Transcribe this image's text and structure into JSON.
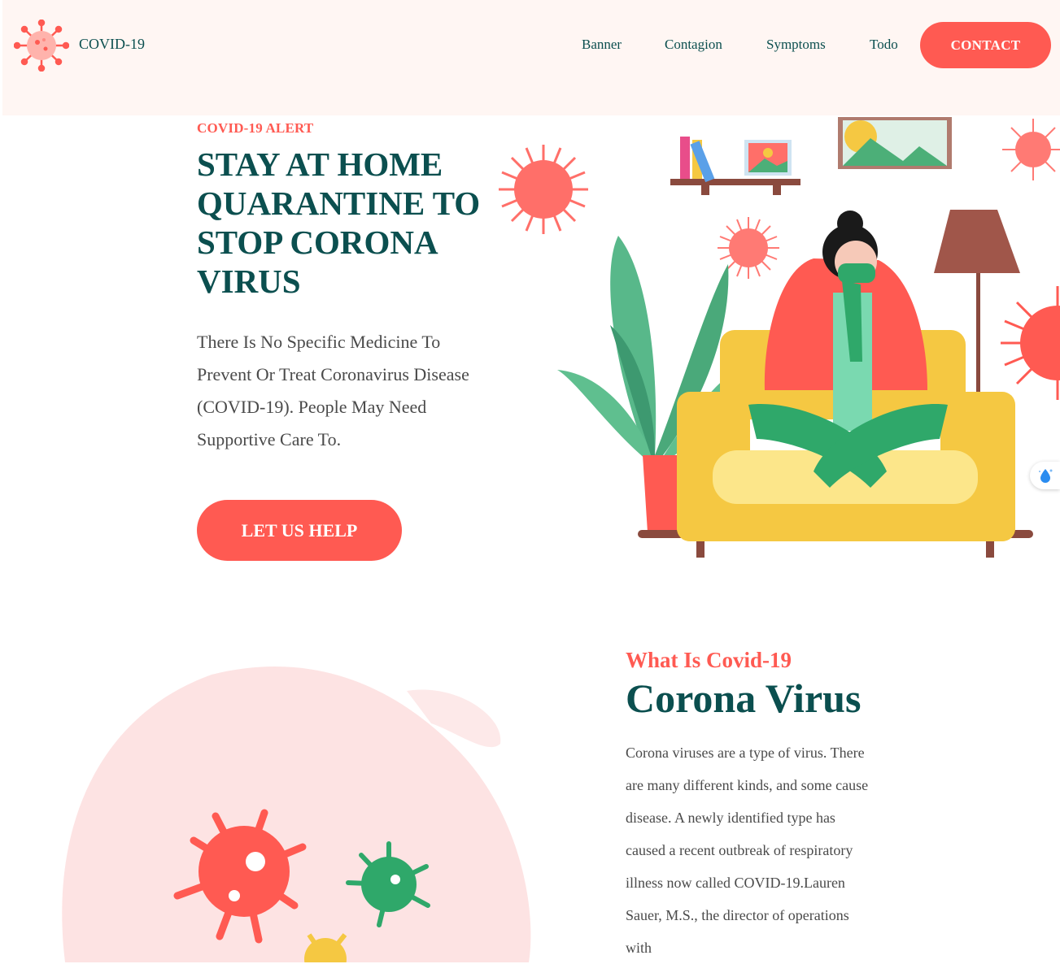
{
  "header": {
    "logo_text": "COVID-19",
    "nav": [
      "Banner",
      "Contagion",
      "Symptoms",
      "Todo"
    ],
    "contact_label": "CONTACT"
  },
  "hero": {
    "eyebrow": "COVID-19 ALERT",
    "title": "STAY AT HOME QUARANTINE TO STOP CORONA VIRUS",
    "description": "There Is No Specific Medicine To Prevent Or Treat Coronavirus Disease (COVID-19). People May Need Supportive Care To.",
    "cta_label": "LET US HELP"
  },
  "about": {
    "eyebrow": "What Is Covid-19",
    "title": "Corona Virus",
    "description": "Corona viruses are a type of virus. There are many different kinds, and some cause disease. A newly identified type has caused a recent outbreak of respiratory illness now called COVID-19.Lauren Sauer, M.S., the director of operations with"
  },
  "colors": {
    "accent": "#ff5a52",
    "heading": "#0b4f4f",
    "body_text": "#4a4a4a",
    "header_bg": "#fff6f3"
  },
  "icons": [
    "virus-logo-icon",
    "water-drop-icon"
  ]
}
